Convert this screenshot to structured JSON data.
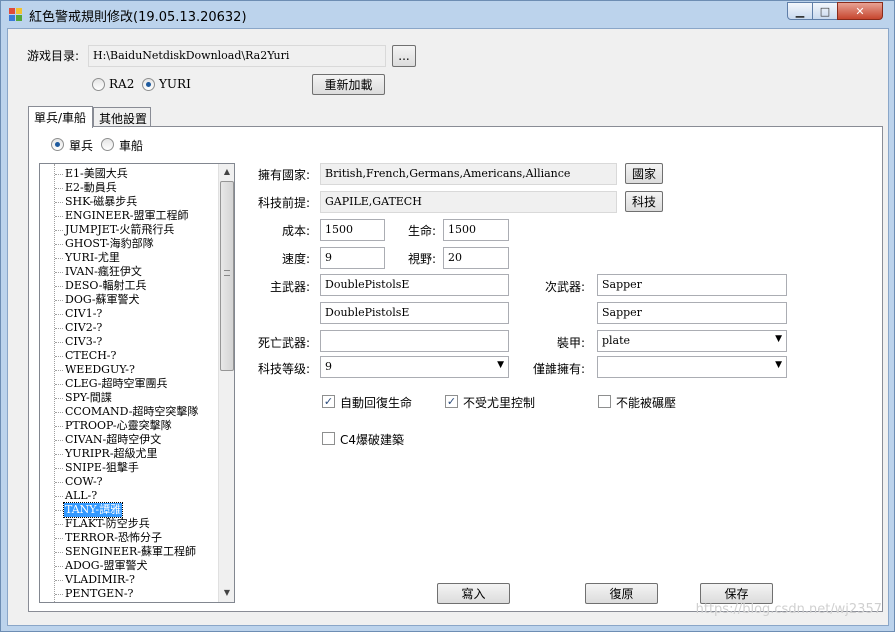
{
  "window": {
    "title": "紅色警戒規則修改(19.05.13.20632)",
    "controls": {
      "minimize": "▁",
      "maximize": "□",
      "close": "✕"
    }
  },
  "game_dir": {
    "label": "游戏目录:",
    "value": "H:\\BaiduNetdiskDownload\\Ra2Yuri",
    "browse_label": "..."
  },
  "mode": {
    "options": [
      {
        "label": "RA2",
        "selected": false
      },
      {
        "label": "YURI",
        "selected": true
      }
    ],
    "reload_label": "重新加載"
  },
  "tabs": [
    {
      "label": "單兵/車船",
      "active": true
    },
    {
      "label": "其他設置",
      "active": false
    }
  ],
  "unit_type": {
    "options": [
      {
        "label": "單兵",
        "selected": true
      },
      {
        "label": "車船",
        "selected": false
      }
    ]
  },
  "unit_list": {
    "items": [
      "E1-美國大兵",
      "E2-動員兵",
      "SHK-磁暴步兵",
      "ENGINEER-盟軍工程師",
      "JUMPJET-火箭飛行兵",
      "GHOST-海豹部隊",
      "YURI-尤里",
      "IVAN-瘋狂伊文",
      "DESO-輻射工兵",
      "DOG-蘇軍警犬",
      "CIV1-?",
      "CIV2-?",
      "CIV3-?",
      "CTECH-?",
      "WEEDGUY-?",
      "CLEG-超時空軍團兵",
      "SPY-間諜",
      "CCOMAND-超時空突擊隊",
      "PTROOP-心靈突擊隊",
      "CIVAN-超時空伊文",
      "YURIPR-超級尤里",
      "SNIPE-狙擊手",
      "COW-?",
      "ALL-?",
      "TANY-譚雅",
      "FLAKT-防空步兵",
      "TERROR-恐怖分子",
      "SENGINEER-蘇軍工程師",
      "ADOG-盟軍警犬",
      "VLADIMIR-?",
      "PENTGEN-?"
    ],
    "selected_index": 24
  },
  "form": {
    "owner": {
      "label": "擁有國家:",
      "value": "British,French,Germans,Americans,Alliance",
      "button": "國家"
    },
    "prereq": {
      "label": "科技前提:",
      "value": "GAPILE,GATECH",
      "button": "科技"
    },
    "cost": {
      "label": "成本:",
      "value": "1500"
    },
    "strength": {
      "label": "生命:",
      "value": "1500"
    },
    "speed": {
      "label": "速度:",
      "value": "9"
    },
    "sight": {
      "label": "視野:",
      "value": "20"
    },
    "primary": {
      "label": "主武器:",
      "value1": "DoublePistolsE",
      "value2": "DoublePistolsE"
    },
    "secondary": {
      "label": "次武器:",
      "value1": "Sapper",
      "value2": "Sapper"
    },
    "death_weapon": {
      "label": "死亡武器:",
      "value": ""
    },
    "armor": {
      "label": "裝甲:",
      "value": "plate"
    },
    "tech_level": {
      "label": "科技等级:",
      "value": "9"
    },
    "owner_only": {
      "label": "僅誰擁有:",
      "value": ""
    },
    "checks": [
      {
        "label": "自動回復生命",
        "checked": true
      },
      {
        "label": "不受尤里控制",
        "checked": true
      },
      {
        "label": "不能被碾壓",
        "checked": false
      },
      {
        "label": "C4爆破建築",
        "checked": false
      }
    ]
  },
  "actions": {
    "write": "寫入",
    "restore": "復原",
    "save": "保存"
  },
  "watermark": "https://blog.csdn.net/wj2357"
}
